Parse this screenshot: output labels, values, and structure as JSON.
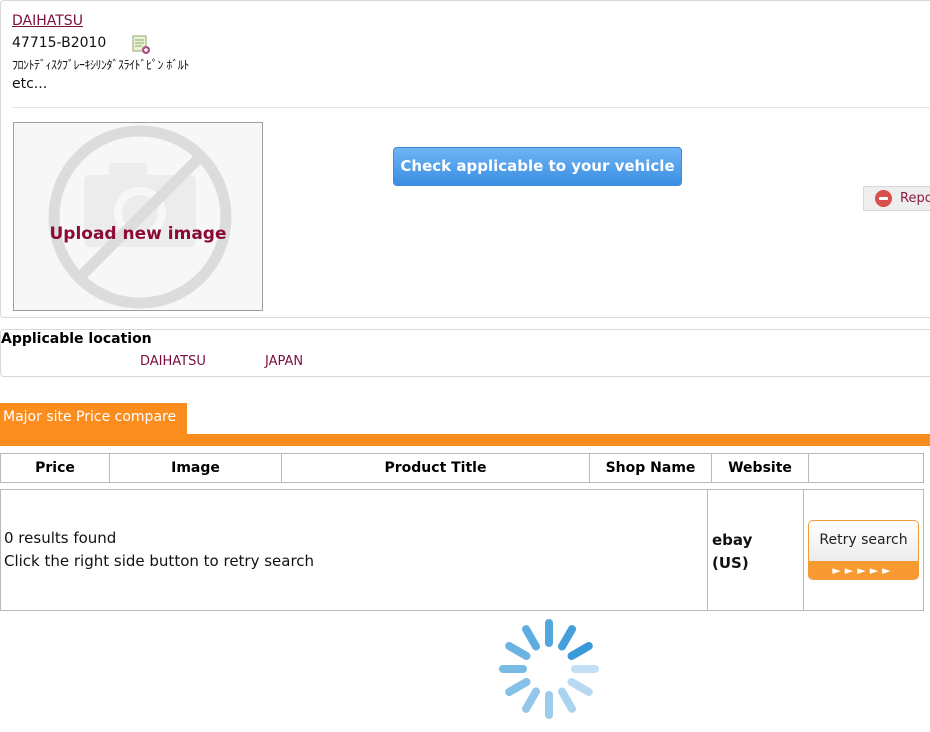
{
  "part": {
    "brand": "DAIHATSU",
    "number": "47715-B2010",
    "name": "ﾌﾛﾝﾄﾃﾞｨｽｸﾌﾞﾚｰｷｼﾘﾝﾀﾞｽﾗｲﾄﾞﾋﾟﾝ ﾎﾞﾙﾄ",
    "more": "etc...",
    "note_icon": "add-note-icon"
  },
  "image": {
    "upload_label": "Upload new image",
    "placeholder_icon": "no-image-camera-icon"
  },
  "check_button": "Check applicable to your vehicle",
  "report_button": {
    "label": "Report",
    "icon": "minus-circle-icon",
    "color": "#d8504c"
  },
  "applicable": {
    "title": "Applicable location",
    "brand": "DAIHATSU",
    "country": "JAPAN"
  },
  "price_compare": {
    "tab_label": "Major site Price compare",
    "accent": "#fb8c1e",
    "columns": [
      "Price",
      "Image",
      "Product Title",
      "Shop Name",
      "Website",
      ""
    ],
    "result_count": "0 results found",
    "result_hint": "Click the right side button to retry search",
    "website": "ebay (US)",
    "retry_label": "Retry search",
    "retry_arrows": "►►►►►"
  },
  "loading": {
    "icon": "loading-spinner-icon",
    "color": "#3a9ad9"
  }
}
